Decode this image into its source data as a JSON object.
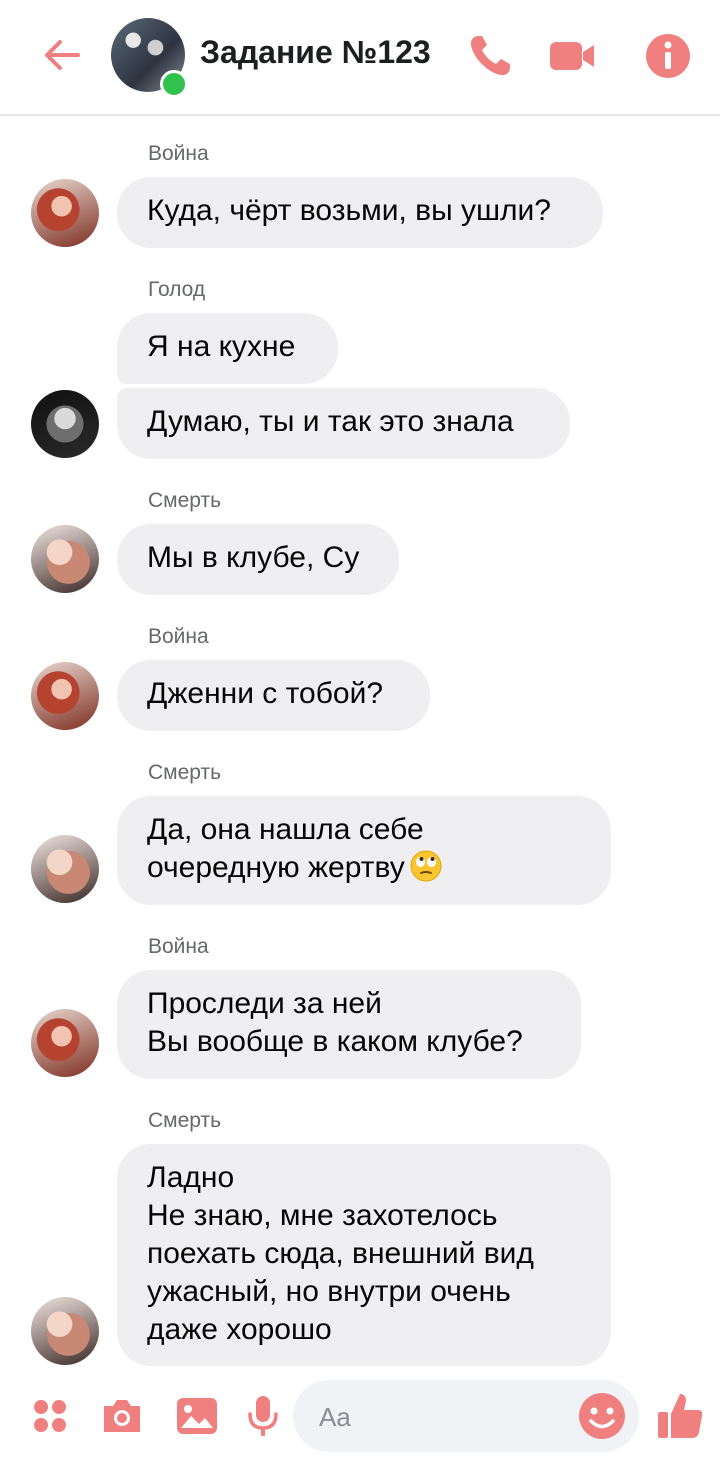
{
  "header": {
    "title": "Задание №123",
    "accent_color": "#f08080"
  },
  "messages": [
    {
      "sender": "Война",
      "lines": [
        "Куда, чёрт возьми, вы ушли?"
      ]
    },
    {
      "sender": "Голод",
      "lines": [
        "Я на кухне"
      ]
    },
    {
      "sender": "",
      "lines": [
        "Думаю, ты и так это знала"
      ]
    },
    {
      "sender": "Смерть",
      "lines": [
        "Мы в клубе, Су"
      ]
    },
    {
      "sender": "Война",
      "lines": [
        "Дженни с тобой?"
      ]
    },
    {
      "sender": "Смерть",
      "lines": [
        "Да, она нашла себе",
        "очередную жертву"
      ],
      "emoji": "face-with-rolling-eyes"
    },
    {
      "sender": "Война",
      "lines": [
        "Проследи за ней",
        "Вы вообще в каком клубе?"
      ]
    },
    {
      "sender": "Смерть",
      "lines": [
        "Ладно",
        "Не знаю, мне захотелось",
        "поехать сюда, внешний вид",
        "ужасный, но внутри очень",
        "даже хорошо"
      ]
    }
  ],
  "composer": {
    "placeholder": "Aa",
    "icons": [
      "apps-icon",
      "camera-icon",
      "image-icon",
      "microphone-icon",
      "smile-icon",
      "thumbs-up-icon"
    ]
  }
}
